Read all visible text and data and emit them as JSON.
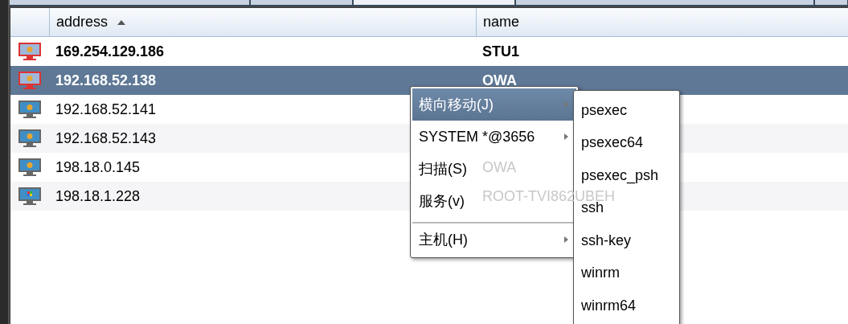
{
  "table": {
    "columns": [
      {
        "label": "address",
        "sorted": true
      },
      {
        "label": "name",
        "sorted": false
      }
    ],
    "rows": [
      {
        "address": "169.254.129.186",
        "name": "STU1",
        "compromised": true,
        "kind": "vista",
        "bold": true,
        "selected": false,
        "name_faded": false
      },
      {
        "address": "192.168.52.138",
        "name": "OWA",
        "compromised": true,
        "kind": "vista",
        "bold": true,
        "selected": true
      },
      {
        "address": "192.168.52.141",
        "compromised": false,
        "kind": "vista",
        "bold": false,
        "selected": false
      },
      {
        "address": "192.168.52.143",
        "compromised": false,
        "kind": "vista",
        "bold": false,
        "selected": false
      },
      {
        "address": "198.18.0.145",
        "name": "OWA",
        "compromised": false,
        "kind": "vista",
        "bold": false,
        "selected": false,
        "name_faded": true
      },
      {
        "address": "198.18.1.228",
        "name": "ROOT-TVI862UBEH",
        "compromised": false,
        "kind": "xp",
        "bold": false,
        "selected": false,
        "name_faded": true
      }
    ]
  },
  "context_menu": {
    "items": [
      {
        "label": "横向移动(J)",
        "submenu": true,
        "selected": true
      },
      {
        "label": "SYSTEM *@3656",
        "submenu": true,
        "selected": false
      },
      {
        "label": "扫描(S)",
        "submenu": false,
        "selected": false
      },
      {
        "label": "服务(v)",
        "submenu": false,
        "selected": false
      },
      {
        "label": "主机(H)",
        "submenu": true,
        "selected": false,
        "separator_before": true
      }
    ]
  },
  "submenu": {
    "items": [
      "psexec",
      "psexec64",
      "psexec_psh",
      "ssh",
      "ssh-key",
      "winrm",
      "winrm64"
    ]
  }
}
